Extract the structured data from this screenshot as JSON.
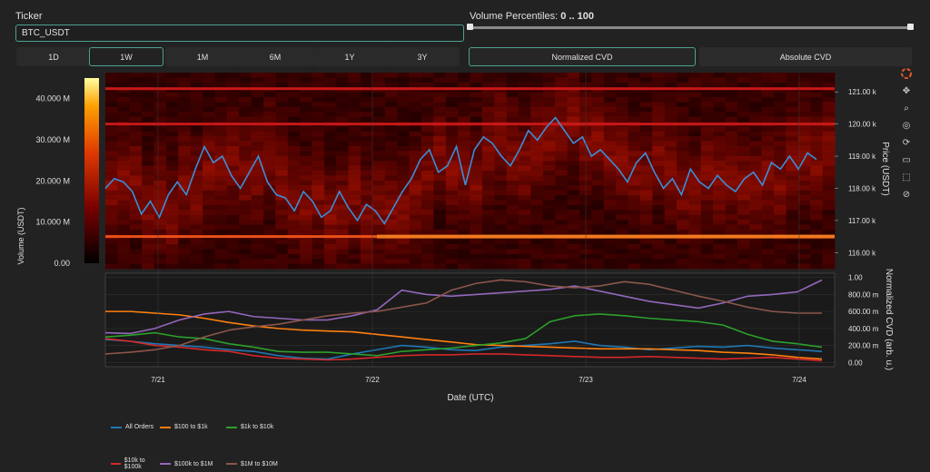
{
  "ticker": {
    "label": "Ticker",
    "value": "BTC_USDT"
  },
  "volume_percentiles": {
    "label": "Volume Percentiles:",
    "value": "0 .. 100",
    "low": 0,
    "high": 100
  },
  "ranges": [
    "1D",
    "1W",
    "1M",
    "6M",
    "1Y",
    "3Y"
  ],
  "active_range": "1W",
  "modes": [
    "Normalized CVD",
    "Absolute CVD"
  ],
  "active_mode": "Normalized CVD",
  "modebar_icons": [
    "logo-icon",
    "pan-icon",
    "zoom-icon",
    "lasso-icon",
    "reset-icon",
    "download-icon",
    "box-select-icon",
    "autoscale-icon"
  ],
  "chart_data": [
    {
      "type": "heatmap",
      "overlay": "line",
      "ylabel_left": "Volume (USDT)",
      "ylabel_right": "Price (USDT)",
      "colorbar_ticks": [
        "0.00",
        "10.000 M",
        "20.000 M",
        "30.000 M",
        "40.000 M"
      ],
      "colorbar_range": [
        0,
        45000000
      ],
      "price_ticks": [
        "116.00 k",
        "117.00 k",
        "118.00 k",
        "119.00 k",
        "120.00 k",
        "121.00 k"
      ],
      "price_range": [
        115500,
        121600
      ],
      "price_series": [
        118.0,
        118.3,
        118.2,
        117.9,
        117.2,
        117.6,
        117.1,
        117.8,
        118.2,
        117.8,
        118.6,
        119.3,
        118.8,
        119.0,
        118.4,
        118.0,
        118.5,
        119.0,
        118.2,
        117.8,
        117.7,
        117.3,
        117.9,
        117.6,
        117.1,
        117.3,
        117.9,
        117.4,
        117.0,
        117.5,
        117.3,
        116.9,
        117.4,
        117.9,
        118.3,
        118.9,
        119.2,
        118.5,
        118.7,
        119.3,
        118.1,
        119.2,
        119.6,
        119.4,
        119.0,
        118.7,
        119.2,
        119.8,
        119.5,
        119.9,
        120.2,
        119.8,
        119.4,
        119.6,
        119.0,
        119.2,
        118.9,
        118.6,
        118.2,
        118.8,
        119.1,
        118.5,
        118.0,
        118.3,
        117.8,
        118.6,
        118.2,
        118.0,
        118.4,
        118.1,
        117.9,
        118.3,
        118.5,
        118.1,
        118.8,
        118.6,
        119.0,
        118.6,
        119.1,
        118.9
      ],
      "high_volume_bands": [
        {
          "price": 120.0,
          "intensity": 0.75
        },
        {
          "price": 121.1,
          "intensity": 0.55
        },
        {
          "price": 116.5,
          "intensity": 0.85
        }
      ]
    },
    {
      "type": "line",
      "xlabel": "Date (UTC)",
      "ylabel": "Normalized CVD (arb. u.)",
      "x_ticks": [
        "7/21",
        "7/22",
        "7/23",
        "7/24"
      ],
      "y_ticks": [
        "0.00",
        "200.00 m",
        "400.00 m",
        "600.00 m",
        "800.00 m",
        "1.00"
      ],
      "ylim": [
        -0.05,
        1.05
      ],
      "series": [
        {
          "name": "All Orders",
          "color": "#1f77b4",
          "values": [
            0.27,
            0.25,
            0.22,
            0.2,
            0.18,
            0.15,
            0.13,
            0.08,
            0.05,
            0.04,
            0.1,
            0.15,
            0.2,
            0.18,
            0.15,
            0.14,
            0.18,
            0.2,
            0.22,
            0.25,
            0.2,
            0.18,
            0.15,
            0.17,
            0.19,
            0.18,
            0.2,
            0.17,
            0.15,
            0.13
          ]
        },
        {
          "name": "$100 to $1k",
          "color": "#ff7f0e",
          "values": [
            0.6,
            0.6,
            0.58,
            0.56,
            0.52,
            0.47,
            0.43,
            0.4,
            0.38,
            0.37,
            0.36,
            0.33,
            0.3,
            0.27,
            0.24,
            0.21,
            0.2,
            0.19,
            0.18,
            0.17,
            0.16,
            0.16,
            0.16,
            0.15,
            0.14,
            0.12,
            0.11,
            0.09,
            0.06,
            0.04
          ]
        },
        {
          "name": "$1k to $10k",
          "color": "#2ca02c",
          "values": [
            0.3,
            0.32,
            0.35,
            0.3,
            0.28,
            0.22,
            0.18,
            0.13,
            0.12,
            0.12,
            0.1,
            0.08,
            0.13,
            0.15,
            0.17,
            0.2,
            0.23,
            0.28,
            0.48,
            0.55,
            0.57,
            0.55,
            0.52,
            0.5,
            0.48,
            0.44,
            0.33,
            0.25,
            0.22,
            0.18
          ]
        },
        {
          "name": "$10k to $100k",
          "color": "#d62728",
          "values": [
            0.28,
            0.25,
            0.2,
            0.18,
            0.15,
            0.13,
            0.08,
            0.05,
            0.04,
            0.03,
            0.04,
            0.06,
            0.08,
            0.09,
            0.09,
            0.1,
            0.1,
            0.09,
            0.08,
            0.07,
            0.06,
            0.06,
            0.07,
            0.06,
            0.05,
            0.04,
            0.05,
            0.06,
            0.04,
            0.02
          ]
        },
        {
          "name": "$100k to $1M",
          "color": "#9467bd",
          "values": [
            0.35,
            0.34,
            0.4,
            0.5,
            0.57,
            0.6,
            0.54,
            0.52,
            0.5,
            0.5,
            0.55,
            0.62,
            0.85,
            0.8,
            0.78,
            0.8,
            0.82,
            0.84,
            0.86,
            0.9,
            0.84,
            0.78,
            0.72,
            0.68,
            0.64,
            0.7,
            0.78,
            0.8,
            0.83,
            0.97
          ]
        },
        {
          "name": "$1M to $10M",
          "color": "#8c564b",
          "values": [
            0.1,
            0.12,
            0.15,
            0.2,
            0.3,
            0.38,
            0.42,
            0.45,
            0.5,
            0.55,
            0.58,
            0.6,
            0.65,
            0.7,
            0.85,
            0.93,
            0.97,
            0.95,
            0.9,
            0.88,
            0.9,
            0.95,
            0.92,
            0.85,
            0.78,
            0.72,
            0.65,
            0.6,
            0.58,
            0.58
          ]
        }
      ]
    }
  ]
}
